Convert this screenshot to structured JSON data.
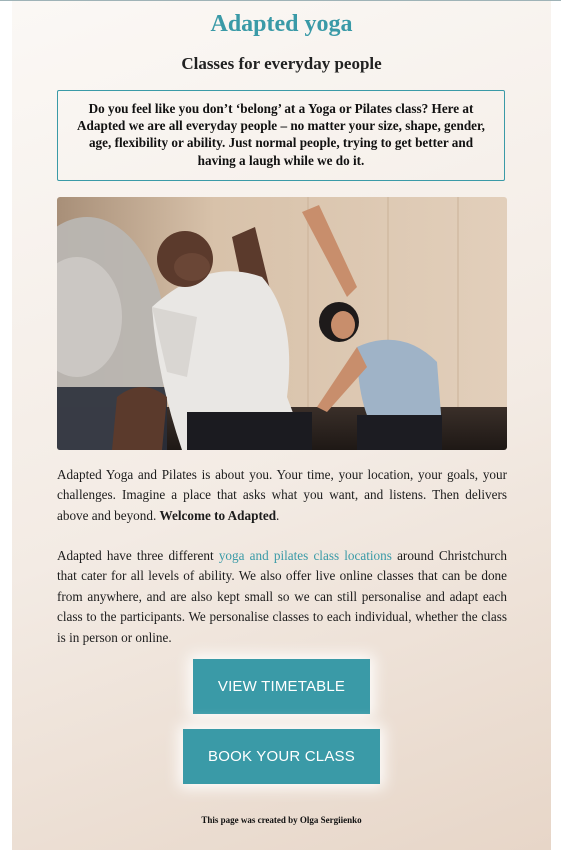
{
  "header": {
    "title": "Adapted yoga",
    "subtitle": "Classes for everyday people"
  },
  "intro": "Do you feel like you don’t ‘belong’ at a Yoga or Pilates class? Here at Adapted we are all everyday people – no matter your size, shape, gender, age, flexibility or ability. Just normal people, trying to get better and having a laugh while we do it.",
  "paragraph1": {
    "text": "Adapted Yoga and Pilates is about you. Your time, your location, your goals, your challenges. Imagine a place that asks what you want, and listens. Then delivers above and beyond.",
    "bold": "Welcome to Adapted",
    "end": "."
  },
  "paragraph2": {
    "before": "Adapted have three different",
    "link": "yoga and pilates class locations",
    "after": "around Christchurch that cater for all levels of ability. We also offer live online classes that can be done from anywhere, and are also kept small so we can still personalise and adapt each class to the participants. We personalise classes to each individual, whether the class is in person or online."
  },
  "buttons": {
    "timetable": "VIEW TIMETABLE",
    "book": "BOOK YOUR CLASS"
  },
  "footer": "This page was created by Olga Sergiienko",
  "colors": {
    "accent": "#3a9aa7",
    "text": "#1c1c1c"
  },
  "images": {
    "hero": "photo-yoga-class-stretching"
  }
}
